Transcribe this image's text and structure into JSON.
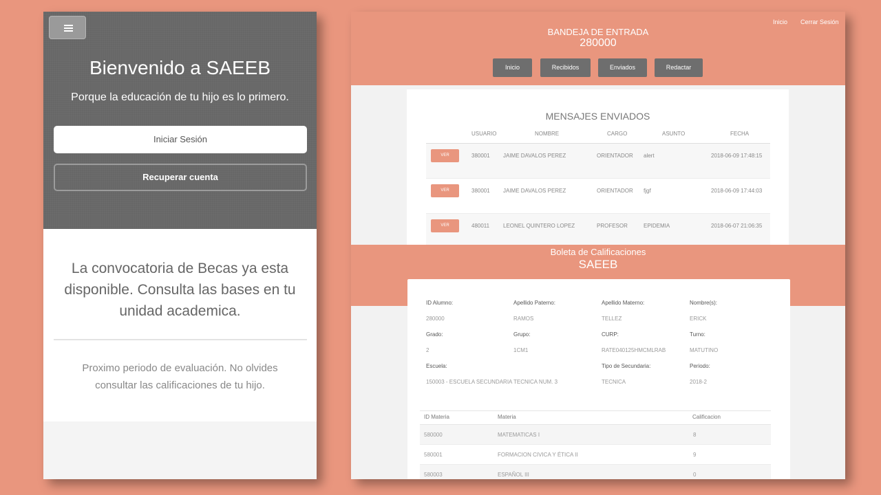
{
  "mobile": {
    "menu_icon": "hamburger-icon",
    "title": "Bienvenido a SAEEB",
    "subtitle": "Porque la educación de tu hijo es lo primero.",
    "login_button": "Iniciar Sesión",
    "recover_button": "Recuperar cuenta",
    "announcement": "La convocatoria de Becas ya esta disponible. Consulta las bases en tu unidad academica.",
    "evaluation": "Proximo periodo de evaluación. No olvides consultar las calificaciones de tu hijo."
  },
  "inbox": {
    "nav": {
      "home": "Inicio",
      "logout": "Cerrar Sesión"
    },
    "title": "BANDEJA DE ENTRADA",
    "user_id": "280000",
    "buttons": {
      "home": "Inicio",
      "received": "Recibidos",
      "sent": "Enviados",
      "compose": "Redactar"
    },
    "sent_title": "MENSAJES ENVIADOS",
    "columns": {
      "user": "USUARIO",
      "name": "NOMBRE",
      "role": "CARGO",
      "subject": "ASUNTO",
      "date": "FECHA"
    },
    "view_label": "VER",
    "rows": [
      {
        "user": "380001",
        "name": "JAIME DAVALOS PEREZ",
        "role": "ORIENTADOR",
        "subject": "alert",
        "date": "2018-06-09 17:48:15"
      },
      {
        "user": "380001",
        "name": "JAIME DAVALOS PEREZ",
        "role": "ORIENTADOR",
        "subject": "fjgf",
        "date": "2018-06-09 17:44:03"
      },
      {
        "user": "480011",
        "name": "LEONEL QUINTERO LOPEZ",
        "role": "PROFESOR",
        "subject": "EPIDEMIA",
        "date": "2018-06-07 21:06:35"
      }
    ]
  },
  "report": {
    "title": "Boleta de Calificaciones",
    "subtitle": "SAEEB",
    "fields": {
      "student_id_label": "ID Alumno:",
      "student_id": "280000",
      "paternal_label": "Apellido Paterno:",
      "paternal": "RAMOS",
      "maternal_label": "Apellido Materno:",
      "maternal": "TELLEZ",
      "names_label": "Nombre(s):",
      "names": "ERICK",
      "grade_label": "Grado:",
      "grade": "2",
      "group_label": "Grupo:",
      "group": "1CM1",
      "curp_label": "CURP:",
      "curp": "RATE040125HMCMLRAB",
      "shift_label": "Turno:",
      "shift": "MATUTINO",
      "school_label": "Escuela:",
      "school": "150003 - ESCUELA SECUNDARIA TECNICA NUM. 3",
      "type_label": "Tipo de Secundaria:",
      "type": "TECNICA",
      "period_label": "Periodo:",
      "period": "2018-2"
    },
    "columns": {
      "id": "ID Materia",
      "subject": "Materia",
      "grade": "Calificacion"
    },
    "rows": [
      {
        "id": "580000",
        "subject": "MATEMATICAS I",
        "grade": "8"
      },
      {
        "id": "580001",
        "subject": "FORMACION CIVICA Y ÉTICA II",
        "grade": "9"
      },
      {
        "id": "580003",
        "subject": "ESPAÑOL III",
        "grade": "0"
      }
    ]
  },
  "colors": {
    "accent": "#e9967e",
    "dark": "#676767",
    "button": "#6e6e6e"
  }
}
